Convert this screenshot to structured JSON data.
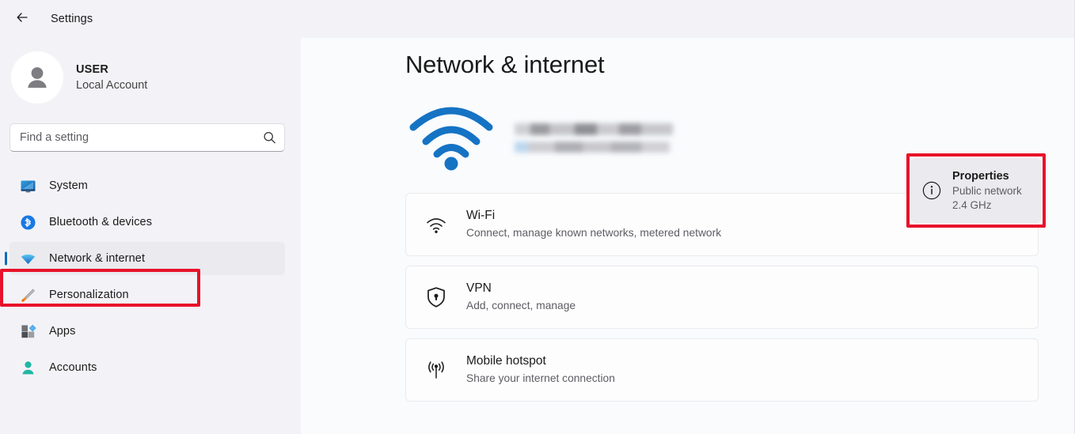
{
  "window": {
    "title": "Settings",
    "back_icon": "arrow-left-icon"
  },
  "sidebar": {
    "account": {
      "name": "USER",
      "subtitle": "Local Account",
      "avatar_icon": "person-avatar-icon"
    },
    "search": {
      "placeholder": "Find a setting",
      "value": "",
      "icon": "search-icon"
    },
    "items": [
      {
        "label": "System",
        "icon": "monitor-icon",
        "selected": false
      },
      {
        "label": "Bluetooth & devices",
        "icon": "bluetooth-icon",
        "selected": false
      },
      {
        "label": "Network & internet",
        "icon": "wifi-icon",
        "selected": true
      },
      {
        "label": "Personalization",
        "icon": "paintbrush-icon",
        "selected": false
      },
      {
        "label": "Apps",
        "icon": "apps-icon",
        "selected": false
      },
      {
        "label": "Accounts",
        "icon": "person-icon",
        "selected": false
      }
    ]
  },
  "main": {
    "title": "Network & internet",
    "status": {
      "icon": "wifi-signal-icon",
      "network_name": "",
      "network_status": "",
      "redacted": true
    },
    "properties_card": {
      "icon": "info-circle-icon",
      "title": "Properties",
      "line1": "Public network",
      "line2": "2.4 GHz"
    },
    "rows": [
      {
        "icon": "wifi-icon",
        "title": "Wi-Fi",
        "subtitle": "Connect, manage known networks, metered network"
      },
      {
        "icon": "shield-lock-icon",
        "title": "VPN",
        "subtitle": "Add, connect, manage"
      },
      {
        "icon": "hotspot-antenna-icon",
        "title": "Mobile hotspot",
        "subtitle": "Share your internet connection"
      }
    ]
  },
  "annotations": {
    "highlight_color": "#e8122a",
    "targets": [
      "Network & internet",
      "Properties"
    ]
  },
  "colors": {
    "page_background": "#f3f3f7",
    "main_background": "#f9fbfd",
    "accent": "#0f6cbd",
    "selection": "#eaeaef",
    "text_primary": "#1b1b1b",
    "text_secondary": "#5d5d63"
  }
}
